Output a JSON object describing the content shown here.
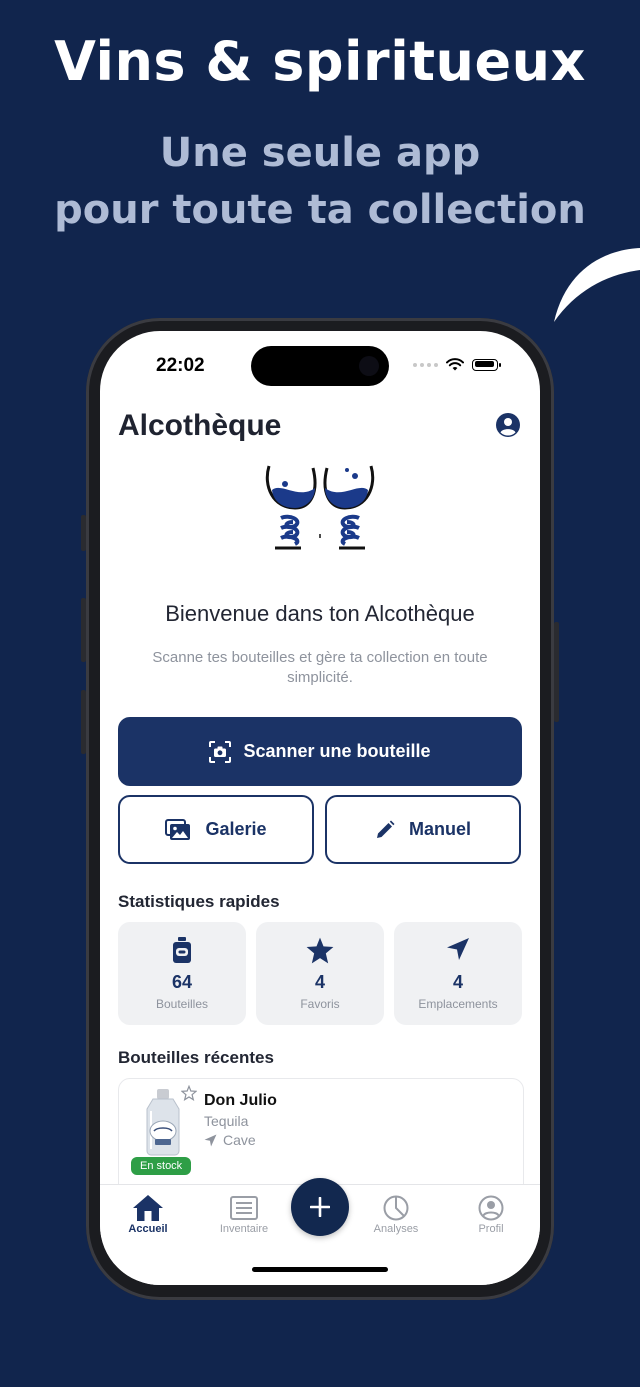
{
  "promo": {
    "title": "Vins & spiritueux",
    "subtitle_line1": "Une seule app",
    "subtitle_line2": "pour toute ta collection"
  },
  "statusbar": {
    "time": "22:02"
  },
  "header": {
    "title": "Alcothèque",
    "profile_icon": "person-circle-icon"
  },
  "welcome": {
    "title": "Bienvenue dans ton Alcothèque",
    "description": "Scanne tes bouteilles et gère ta collection en toute simplicité."
  },
  "actions": {
    "scan_label": "Scanner une bouteille",
    "gallery_label": "Galerie",
    "manual_label": "Manuel"
  },
  "stats": {
    "section_title": "Statistiques rapides",
    "items": [
      {
        "icon": "bottle-icon",
        "value": "64",
        "label": "Bouteilles"
      },
      {
        "icon": "star-icon",
        "value": "4",
        "label": "Favoris"
      },
      {
        "icon": "location-arrow-icon",
        "value": "4",
        "label": "Emplacements"
      }
    ]
  },
  "recent": {
    "section_title": "Bouteilles récentes",
    "items": [
      {
        "name": "Don Julio",
        "type": "Tequila",
        "location": "Cave",
        "badge": "En stock",
        "favorite": false
      }
    ]
  },
  "tabbar": {
    "items": [
      {
        "label": "Accueil",
        "icon": "home-icon",
        "active": true
      },
      {
        "label": "Inventaire",
        "icon": "inventory-icon",
        "active": false
      },
      {
        "label": "Analyses",
        "icon": "pie-chart-icon",
        "active": false
      },
      {
        "label": "Profil",
        "icon": "person-circle-icon",
        "active": false
      }
    ],
    "fab_icon": "plus-icon"
  },
  "colors": {
    "background": "#11254d",
    "primary": "#1b3366",
    "badge_green": "#2e9e46",
    "subtitle": "#aebbd5"
  }
}
